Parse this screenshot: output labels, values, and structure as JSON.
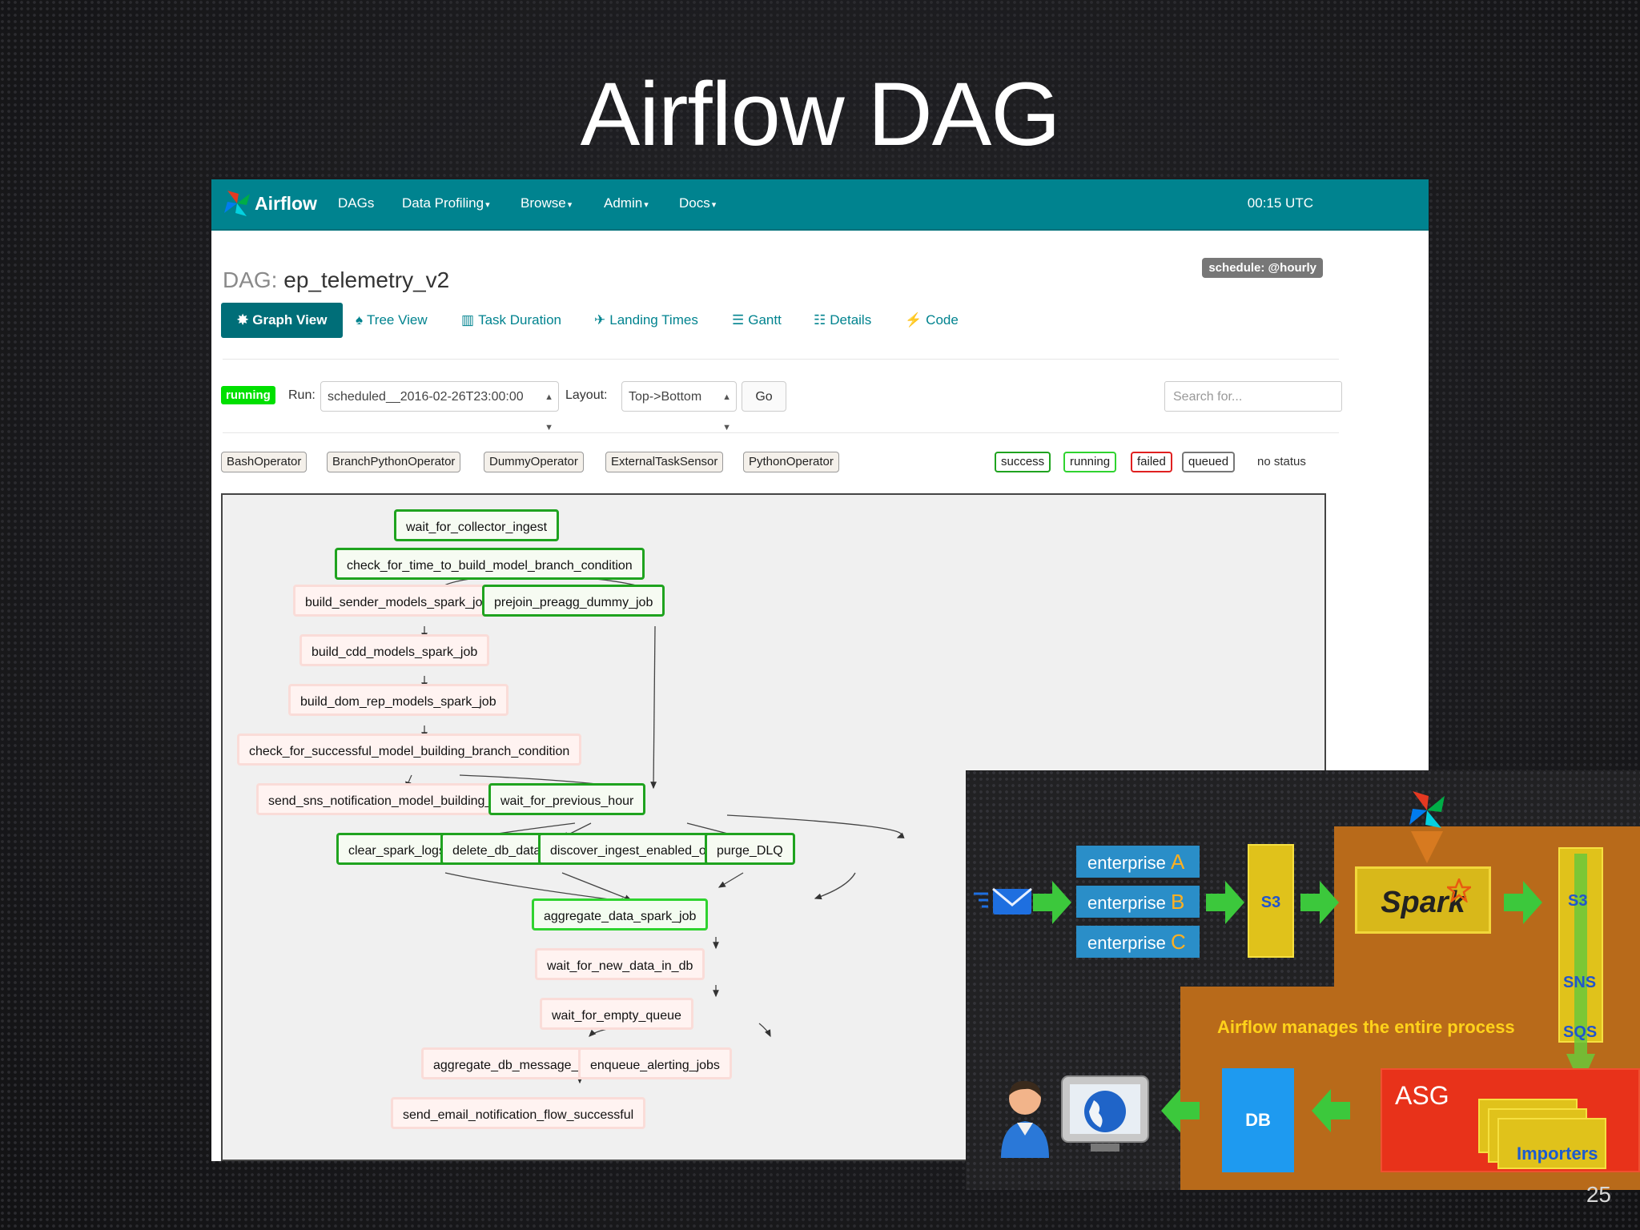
{
  "slide": {
    "title": "Airflow DAG",
    "page_number": "25"
  },
  "navbar": {
    "brand": "Airflow",
    "items": [
      "DAGs",
      "Data Profiling",
      "Browse",
      "Admin",
      "Docs"
    ],
    "caret": "▾",
    "time": "00:15 UTC"
  },
  "dag": {
    "label": "DAG:",
    "name": "ep_telemetry_v2",
    "schedule": "schedule: @hourly"
  },
  "tabs": [
    {
      "label": "Graph View",
      "icon": "asterisk-icon",
      "glyph": "✸"
    },
    {
      "label": "Tree View",
      "icon": "tree-icon",
      "glyph": "♠"
    },
    {
      "label": "Task Duration",
      "icon": "bar-chart-icon",
      "glyph": "▥"
    },
    {
      "label": "Landing Times",
      "icon": "plane-icon",
      "glyph": "✈"
    },
    {
      "label": "Gantt",
      "icon": "gantt-icon",
      "glyph": "☰"
    },
    {
      "label": "Details",
      "icon": "list-icon",
      "glyph": "☷"
    },
    {
      "label": "Code",
      "icon": "flash-icon",
      "glyph": "⚡"
    }
  ],
  "controls": {
    "state": "running",
    "run_label": "Run:",
    "run_value": "scheduled__2016-02-26T23:00:00",
    "layout_label": "Layout:",
    "layout_value": "Top->Bottom",
    "go": "Go",
    "search_placeholder": "Search for..."
  },
  "operators": [
    "BashOperator",
    "BranchPythonOperator",
    "DummyOperator",
    "ExternalTaskSensor",
    "PythonOperator"
  ],
  "statuses": [
    {
      "label": "success",
      "color": "#1fa31f"
    },
    {
      "label": "running",
      "color": "#2fd32f"
    },
    {
      "label": "failed",
      "color": "#e02020"
    },
    {
      "label": "queued",
      "color": "#777777"
    },
    {
      "label": "no status",
      "color": null
    }
  ],
  "colors": {
    "navbar": "#00838f",
    "success": "#1fa31f",
    "running": "#2fd32f",
    "no_status": "#fadcd8"
  },
  "graph": {
    "nodes": [
      {
        "label": "wait_for_collector_ingest",
        "state": "success"
      },
      {
        "label": "check_for_time_to_build_model_branch_condition",
        "state": "success"
      },
      {
        "label": "build_sender_models_spark_job",
        "state": "none"
      },
      {
        "label": "prejoin_preagg_dummy_job",
        "state": "success"
      },
      {
        "label": "build_cdd_models_spark_job",
        "state": "none"
      },
      {
        "label": "build_dom_rep_models_spark_job",
        "state": "none"
      },
      {
        "label": "check_for_successful_model_building_branch_condition",
        "state": "none"
      },
      {
        "label": "send_sns_notification_model_building_failed",
        "state": "none"
      },
      {
        "label": "wait_for_previous_hour",
        "state": "success"
      },
      {
        "label": "clear_spark_logs",
        "state": "success"
      },
      {
        "label": "delete_db_data",
        "state": "success"
      },
      {
        "label": "discover_ingest_enabled_orgs",
        "state": "success"
      },
      {
        "label": "purge_DLQ",
        "state": "success"
      },
      {
        "label": "aggregate_data_spark_job",
        "state": "running"
      },
      {
        "label": "wait_for_new_data_in_db",
        "state": "none"
      },
      {
        "label": "wait_for_empty_queue",
        "state": "none"
      },
      {
        "label": "aggregate_db_message_job",
        "state": "none"
      },
      {
        "label": "enqueue_alerting_jobs",
        "state": "none"
      },
      {
        "label": "send_email_notification_flow_successful",
        "state": "none"
      }
    ]
  },
  "architecture": {
    "enterprises": [
      {
        "word": "enterprise",
        "letter": "A"
      },
      {
        "word": "enterprise",
        "letter": "B"
      },
      {
        "word": "enterprise",
        "letter": "C"
      }
    ],
    "s3": "S3",
    "spark": "Spark",
    "s3_right": "S3",
    "sns": "SNS",
    "sqs": "SQS",
    "caption": "Airflow manages the entire process",
    "db": "DB",
    "asg": "ASG",
    "importers": "Importers",
    "icons": [
      "mail-icon",
      "person-icon",
      "globe-monitor-icon",
      "airflow-pinwheel-icon"
    ]
  }
}
